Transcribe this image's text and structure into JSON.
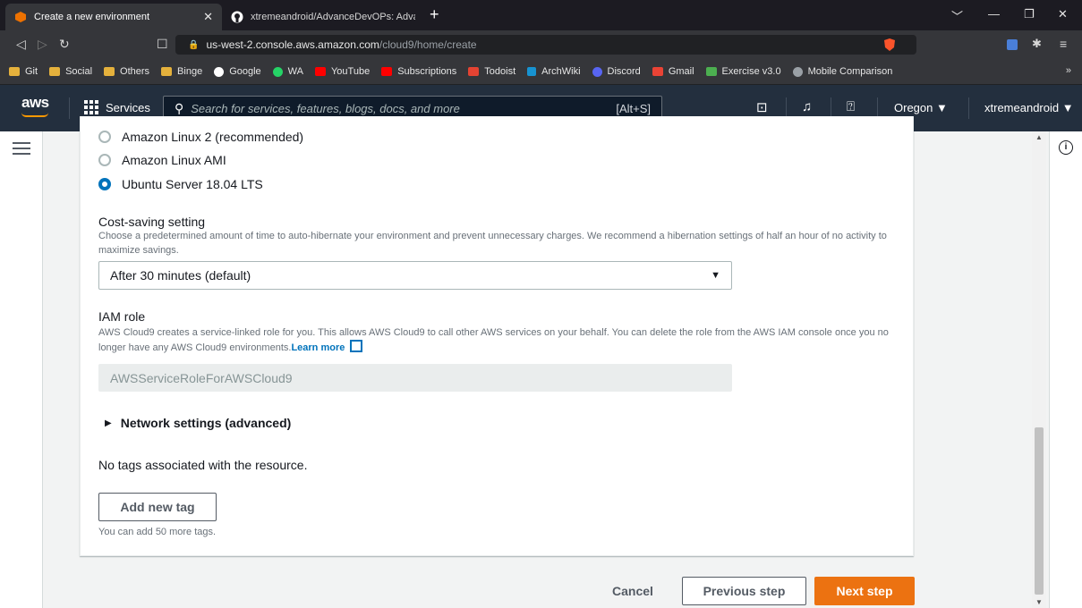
{
  "browser": {
    "tabs": [
      {
        "title": "Create a new environment",
        "icon": "aws-cube-icon"
      },
      {
        "title": "xtremeandroid/AdvanceDevOPs: Adva",
        "icon": "github-icon"
      }
    ],
    "url_host": "us-west-2.console.aws.amazon.com",
    "url_path": "/cloud9/home/create",
    "bookmarks": [
      "Git",
      "Social",
      "Others",
      "Binge",
      "Google",
      "WA",
      "YouTube",
      "Subscriptions",
      "Todoist",
      "ArchWiki",
      "Discord",
      "Gmail",
      "Exercise v3.0",
      "Mobile Comparison"
    ],
    "bookmark_more": "»"
  },
  "awsnav": {
    "logo": "aws",
    "services_label": "Services",
    "search_placeholder": "Search for services, features, blogs, docs, and more",
    "search_shortcut": "[Alt+S]",
    "region": "Oregon ▼",
    "account": "xtremeandroid ▼"
  },
  "form": {
    "platform_options": [
      {
        "label": "Amazon Linux 2 (recommended)",
        "checked": false
      },
      {
        "label": "Amazon Linux AMI",
        "checked": false
      },
      {
        "label": "Ubuntu Server 18.04 LTS",
        "checked": true
      }
    ],
    "cost_saving": {
      "label": "Cost-saving setting",
      "description": "Choose a predetermined amount of time to auto-hibernate your environment and prevent unnecessary charges. We recommend a hibernation settings of half an hour of no activity to maximize savings.",
      "selected": "After 30 minutes (default)"
    },
    "iam_role": {
      "label": "IAM role",
      "description": "AWS Cloud9 creates a service-linked role for you. This allows AWS Cloud9 to call other AWS services on your behalf. You can delete the role from the AWS IAM console once you no longer have any AWS Cloud9 environments.",
      "learn_more": "Learn more",
      "value": "AWSServiceRoleForAWSCloud9"
    },
    "network_settings": "Network settings (advanced)",
    "tags": {
      "empty_text": "No tags associated with the resource.",
      "add_button": "Add new tag",
      "hint": "You can add 50 more tags."
    }
  },
  "footer": {
    "cancel": "Cancel",
    "previous": "Previous step",
    "next": "Next step"
  },
  "colors": {
    "aws_nav": "#232f3e",
    "primary_orange": "#ec7211",
    "link_blue": "#0073bb"
  }
}
